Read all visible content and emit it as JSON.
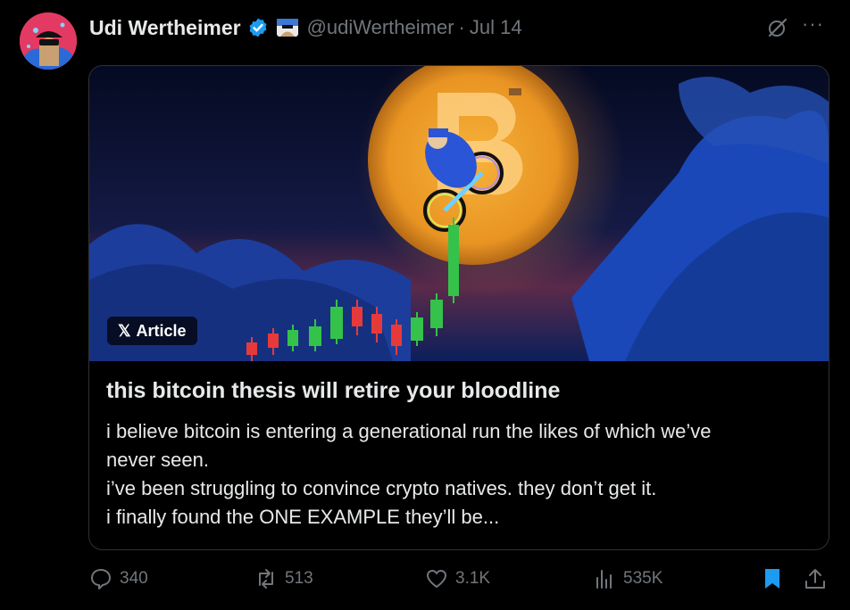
{
  "author": {
    "name": "Udi Wertheimer",
    "handle": "@udiWertheimer",
    "separator": "·",
    "date": "Jul 14",
    "verified_color": "#1d9bf0"
  },
  "card": {
    "badge_x": "𝕏",
    "badge_label": "Article",
    "title": "this bitcoin thesis will retire your bloodline",
    "description": [
      "i believe bitcoin is entering a generational run the likes of which we’ve",
      "never seen.",
      "i’ve been struggling to convince crypto natives. they don’t get it.",
      "i finally found the ONE EXAMPLE they’ll be..."
    ]
  },
  "actions": {
    "replies": "340",
    "reposts": "513",
    "likes": "3.1K",
    "views": "535K",
    "bookmark_color": "#1d9bf0"
  },
  "icons": [
    "grok-icon",
    "more-icon",
    "reply-icon",
    "repost-icon",
    "like-icon",
    "views-icon",
    "bookmark-icon",
    "share-icon"
  ]
}
